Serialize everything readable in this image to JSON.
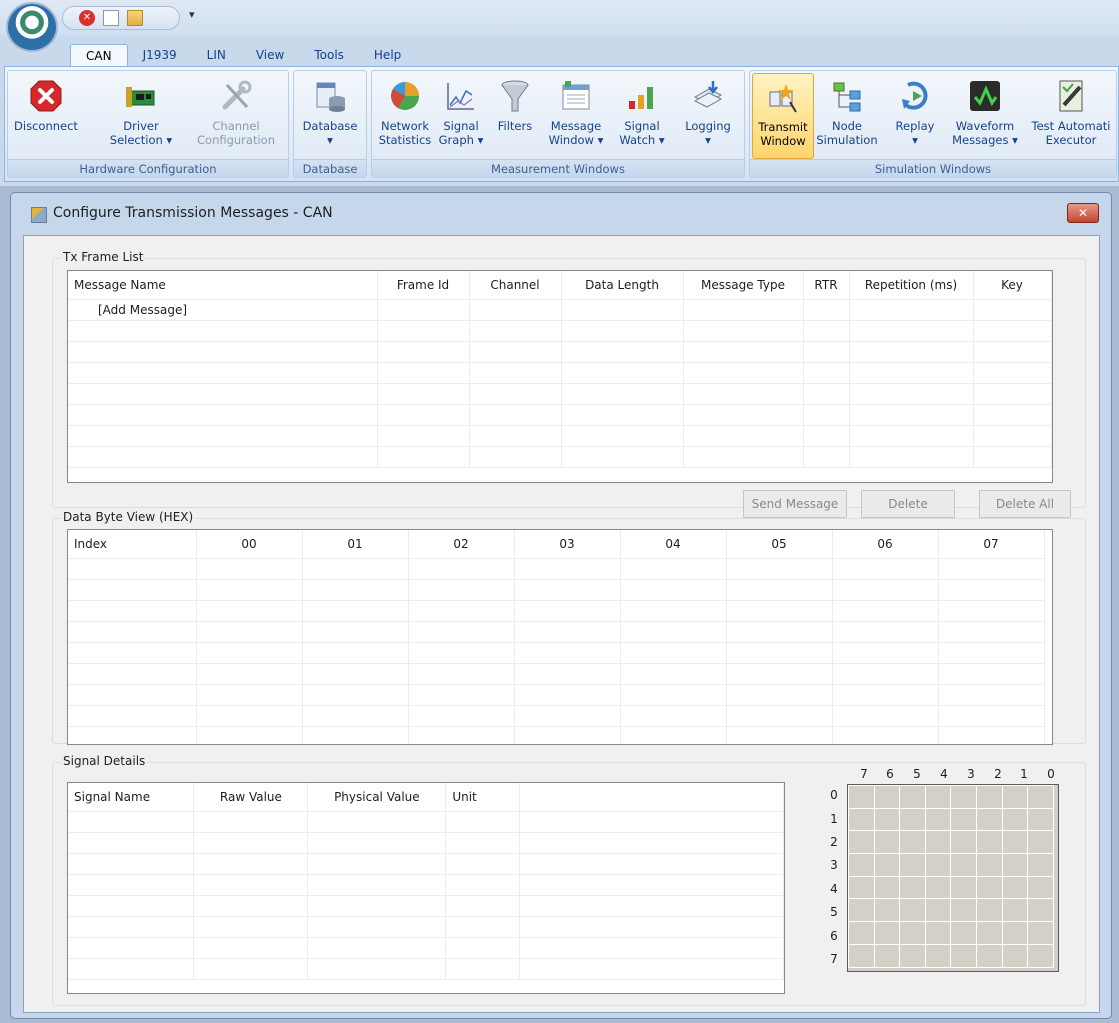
{
  "quick_access": {
    "icons": [
      "stop-icon",
      "new-file-icon",
      "open-folder-icon"
    ],
    "more": "▾"
  },
  "ribbon": {
    "tabs": [
      "CAN",
      "J1939",
      "LIN",
      "View",
      "Tools",
      "Help"
    ],
    "active_tab": "CAN",
    "groups": {
      "hardware": {
        "label": "Hardware Configuration",
        "disconnect": "Disconnect",
        "driver_selection": "Driver\nSelection ▾",
        "channel_configuration": "Channel\nConfiguration"
      },
      "database": {
        "label": "Database",
        "database": "Database\n▾"
      },
      "measurement": {
        "label": "Measurement Windows",
        "network_statistics": "Network\nStatistics",
        "signal_graph": "Signal\nGraph ▾",
        "filters": "Filters",
        "message_window": "Message\nWindow ▾",
        "signal_watch": "Signal\nWatch ▾",
        "logging": "Logging\n▾"
      },
      "simulation": {
        "label": "Simulation Windows",
        "transmit_window": "Transmit\nWindow",
        "node_simulation": "Node\nSimulation",
        "replay": "Replay\n▾",
        "waveform_messages": "Waveform\nMessages ▾",
        "test_automation_executor": "Test Automati\nExecutor"
      }
    }
  },
  "dialog": {
    "title": "Configure Transmission Messages - CAN",
    "close": "✕",
    "tx_frame_list": {
      "legend": "Tx Frame List",
      "columns": [
        "Message Name",
        "Frame Id",
        "Channel",
        "Data Length",
        "Message Type",
        "RTR",
        "Repetition (ms)",
        "Key"
      ],
      "rows": [
        [
          "[Add Message]",
          "",
          "",
          "",
          "",
          "",
          "",
          ""
        ]
      ],
      "buttons": {
        "send": "Send Message",
        "delete": "Delete",
        "delete_all": "Delete All"
      }
    },
    "data_byte_view": {
      "legend": "Data Byte View (HEX)",
      "columns": [
        "Index",
        "00",
        "01",
        "02",
        "03",
        "04",
        "05",
        "06",
        "07"
      ]
    },
    "signal_details": {
      "legend": "Signal Details",
      "columns": [
        "Signal Name",
        "Raw Value",
        "Physical Value",
        "Unit"
      ],
      "bit_columns": [
        "7",
        "6",
        "5",
        "4",
        "3",
        "2",
        "1",
        "0"
      ],
      "bit_rows": [
        "0",
        "1",
        "2",
        "3",
        "4",
        "5",
        "6",
        "7"
      ]
    }
  },
  "colors": {
    "ribbon_label": "#15428b",
    "highlight": "#ffd56b",
    "close_button": "#c4462f"
  }
}
